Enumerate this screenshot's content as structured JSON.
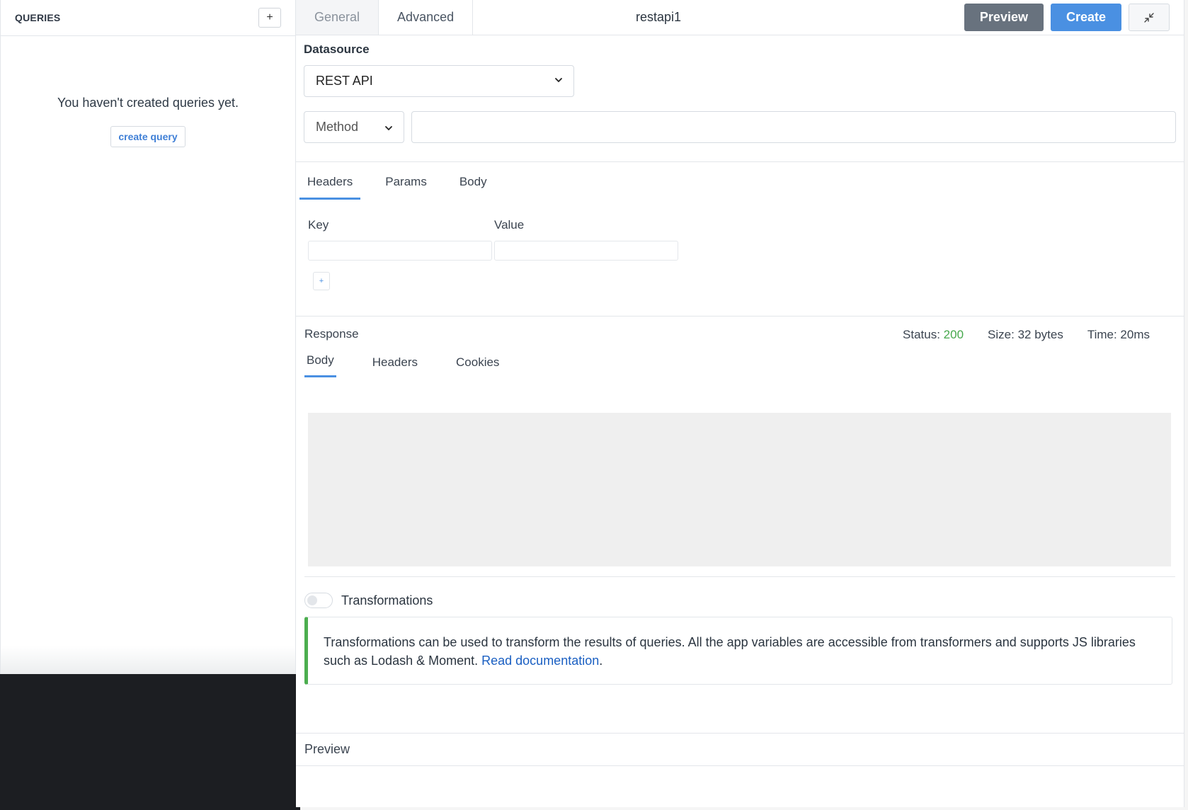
{
  "sidebar": {
    "title": "QUERIES",
    "add_icon": "+",
    "empty_text": "You haven't created queries yet.",
    "create_query_label": "create query"
  },
  "header": {
    "tabs": [
      {
        "label": "General",
        "active": true
      },
      {
        "label": "Advanced",
        "active": false
      }
    ],
    "query_name": "restapi1",
    "preview_label": "Preview",
    "create_label": "Create",
    "collapse_icon": "collapse-icon"
  },
  "datasource": {
    "label": "Datasource",
    "selected": "REST API"
  },
  "request": {
    "method_placeholder": "Method",
    "url_value": "",
    "tabs": [
      {
        "label": "Headers",
        "active": true
      },
      {
        "label": "Params",
        "active": false
      },
      {
        "label": "Body",
        "active": false
      }
    ],
    "key_label": "Key",
    "value_label": "Value",
    "add_row_icon": "+"
  },
  "response": {
    "label": "Response",
    "status_label": "Status:",
    "status_value": "200",
    "size_text": "Size: 32 bytes",
    "time_text": "Time: 20ms",
    "tabs": [
      {
        "label": "Body",
        "active": true
      },
      {
        "label": "Headers",
        "active": false
      },
      {
        "label": "Cookies",
        "active": false
      }
    ]
  },
  "transformations": {
    "label": "Transformations",
    "enabled": false,
    "info_text": "Transformations can be used to transform the results of queries. All the app variables are accessible from transformers and supports JS libraries such as Lodash & Moment. ",
    "link_text": "Read documentation",
    "trailing": "."
  },
  "preview": {
    "label": "Preview"
  },
  "colors": {
    "accent": "#4a90e2",
    "status_ok": "#46a84c",
    "info_border": "#4cae4f"
  }
}
